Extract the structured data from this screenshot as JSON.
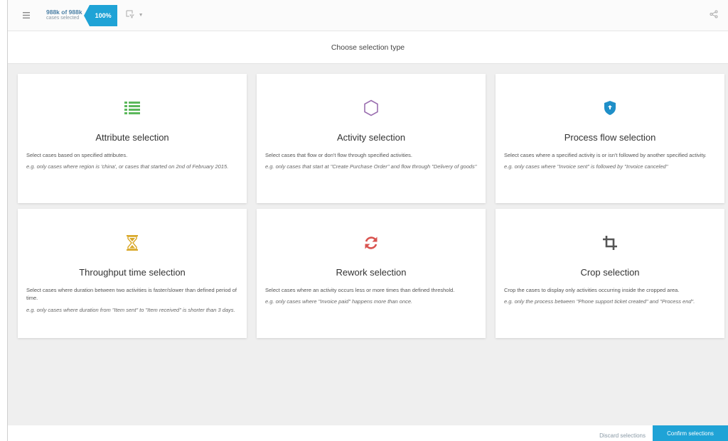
{
  "toolbar": {
    "menu_icon": "hamburger-icon",
    "case_count": "988k of 988k",
    "case_sub": "cases selected",
    "percent": "100%",
    "filter_icon": "filter-icon",
    "share_icon": "share-icon"
  },
  "subheader": {
    "title": "Choose selection type"
  },
  "cards": [
    {
      "title": "Attribute selection",
      "icon": "list-icon",
      "color": "#5cb85c",
      "desc": "Select cases based on specified attributes.",
      "example": "e.g. only cases where region is 'china', or cases that started on 2nd of February 2015."
    },
    {
      "title": "Activity selection",
      "icon": "hexagon-icon",
      "color": "#9b6fb0",
      "desc": "Select cases that flow or don't flow through specified activities.",
      "example": "e.g. only cases that start at \"Create Purchase Order\" and flow through \"Delivery of goods\""
    },
    {
      "title": "Process flow selection",
      "icon": "shield-icon",
      "color": "#1f8fc8",
      "desc": "Select cases where a specified activity is or isn't followed by another specified activity.",
      "example": "e.g. only cases where \"Invoice sent\" is followed by \"Invoice canceled\""
    },
    {
      "title": "Throughput time selection",
      "icon": "hourglass-icon",
      "color": "#d9a829",
      "desc": "Select cases where duration between two activities is faster/slower than defined period of time.",
      "example": "e.g. only cases where duration from \"Item sent\" to \"Item received\" is shorter than 3 days."
    },
    {
      "title": "Rework selection",
      "icon": "refresh-icon",
      "color": "#d9534f",
      "desc": "Select cases where an activity occurs less or more times than defined threshold.",
      "example": "e.g. only cases where \"Invoice paid\" happens more than once."
    },
    {
      "title": "Crop selection",
      "icon": "crop-icon",
      "color": "#555555",
      "desc": "Crop the cases to display only activities occurring inside the cropped area.",
      "example": "e.g. only the process between \"Phone support ticket created\" and \"Process end\"."
    }
  ],
  "footer": {
    "discard_label": "Discard selections",
    "confirm_label": "Confirm selections"
  }
}
